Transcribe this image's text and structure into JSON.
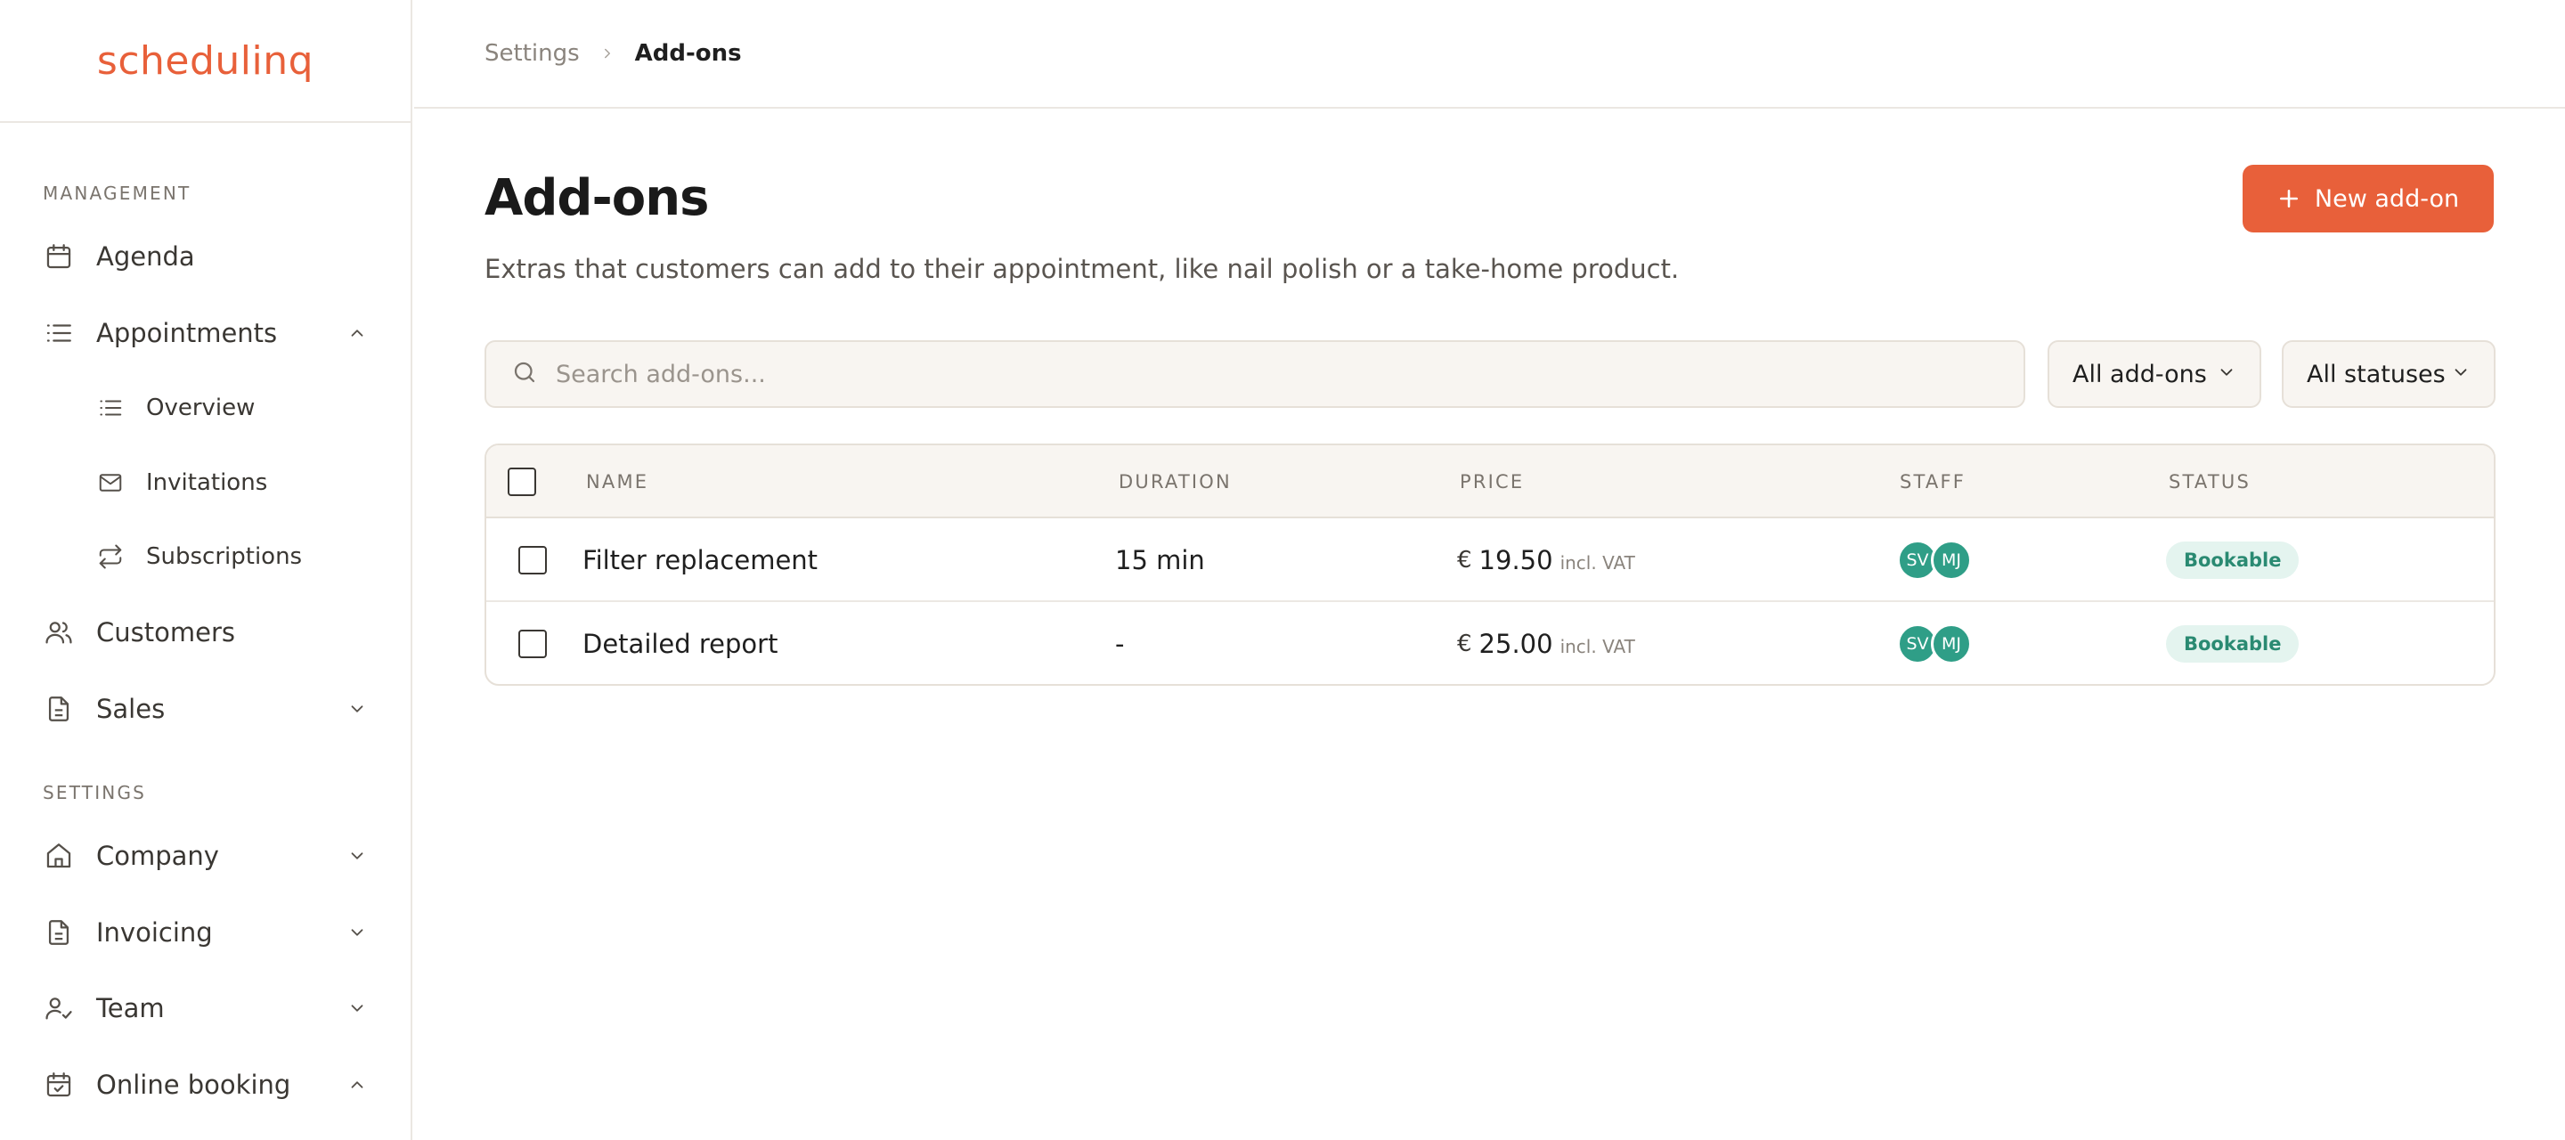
{
  "app": {
    "logo_text": "schedulinq",
    "brand_color": "#e8603a"
  },
  "sidebar": {
    "management_label": "MANAGEMENT",
    "settings_label": "SETTINGS",
    "items": {
      "agenda": {
        "label": "Agenda",
        "icon": "calendar-icon"
      },
      "appointments": {
        "label": "Appointments",
        "icon": "list-icon",
        "expanded": true
      },
      "overview": {
        "label": "Overview",
        "icon": "list-icon"
      },
      "invitations": {
        "label": "Invitations",
        "icon": "mail-icon"
      },
      "subscriptions": {
        "label": "Subscriptions",
        "icon": "repeat-icon"
      },
      "customers": {
        "label": "Customers",
        "icon": "users-icon"
      },
      "sales": {
        "label": "Sales",
        "icon": "document-icon",
        "expanded": false
      },
      "company": {
        "label": "Company",
        "icon": "home-icon",
        "expanded": false
      },
      "invoicing": {
        "label": "Invoicing",
        "icon": "document-icon",
        "expanded": false
      },
      "team": {
        "label": "Team",
        "icon": "user-check-icon",
        "expanded": false
      },
      "online_booking": {
        "label": "Online booking",
        "icon": "calendar-check-icon",
        "expanded": true
      }
    }
  },
  "breadcrumb": {
    "parent": "Settings",
    "current": "Add-ons"
  },
  "page": {
    "title": "Add-ons",
    "subtitle": "Extras that customers can add to their appointment, like nail polish or a take-home product.",
    "new_button_label": "New add-on"
  },
  "search": {
    "placeholder": "Search add-ons...",
    "value": ""
  },
  "filters": {
    "type_selected": "All add-ons",
    "status_selected": "All statuses"
  },
  "table": {
    "columns": {
      "name": "NAME",
      "duration": "DURATION",
      "price": "PRICE",
      "staff": "STAFF",
      "status": "STATUS"
    },
    "rows": [
      {
        "name": "Filter replacement",
        "duration": "15 min",
        "currency": "€",
        "price": "19.50",
        "vat": "incl. VAT",
        "staff": [
          "SV",
          "MJ"
        ],
        "status": "Bookable"
      },
      {
        "name": "Detailed report",
        "duration": "-",
        "currency": "€",
        "price": "25.00",
        "vat": "incl. VAT",
        "staff": [
          "SV",
          "MJ"
        ],
        "status": "Bookable"
      }
    ]
  }
}
